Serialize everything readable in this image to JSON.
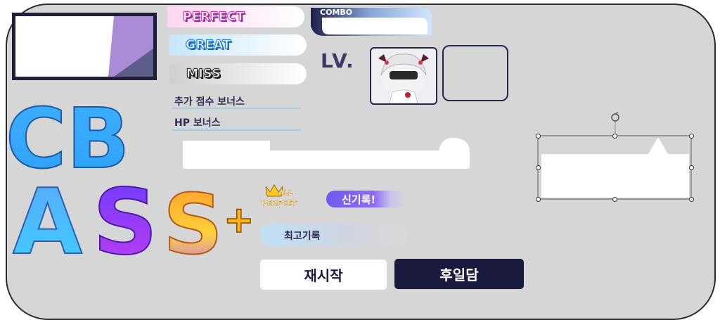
{
  "judgements": {
    "perfect": "PERFECT",
    "great": "GREAT",
    "miss": "MISS"
  },
  "combo": {
    "label": "COMBO"
  },
  "bonus": {
    "extra_score": "추가 점수 보너스",
    "hp": "HP 보너스"
  },
  "level": {
    "label": "LV."
  },
  "rank": {
    "line1": "CB",
    "line2_a": "A",
    "line2_s1": "S",
    "line2_s2": "S",
    "plus": "+"
  },
  "badges": {
    "all_perfect_1": "ALL",
    "all_perfect_2": "PERFCET",
    "new_record": "신기록!",
    "best_record": "최고기록"
  },
  "buttons": {
    "restart": "재시작",
    "sequel": "후일담"
  },
  "colors": {
    "panel": "#d6d6d6",
    "navy": "#1a1a3e",
    "perfect": "#f15ab9",
    "great": "#3ba7f0",
    "miss": "#8a8a8a",
    "new_record": "#7b5cf5"
  }
}
